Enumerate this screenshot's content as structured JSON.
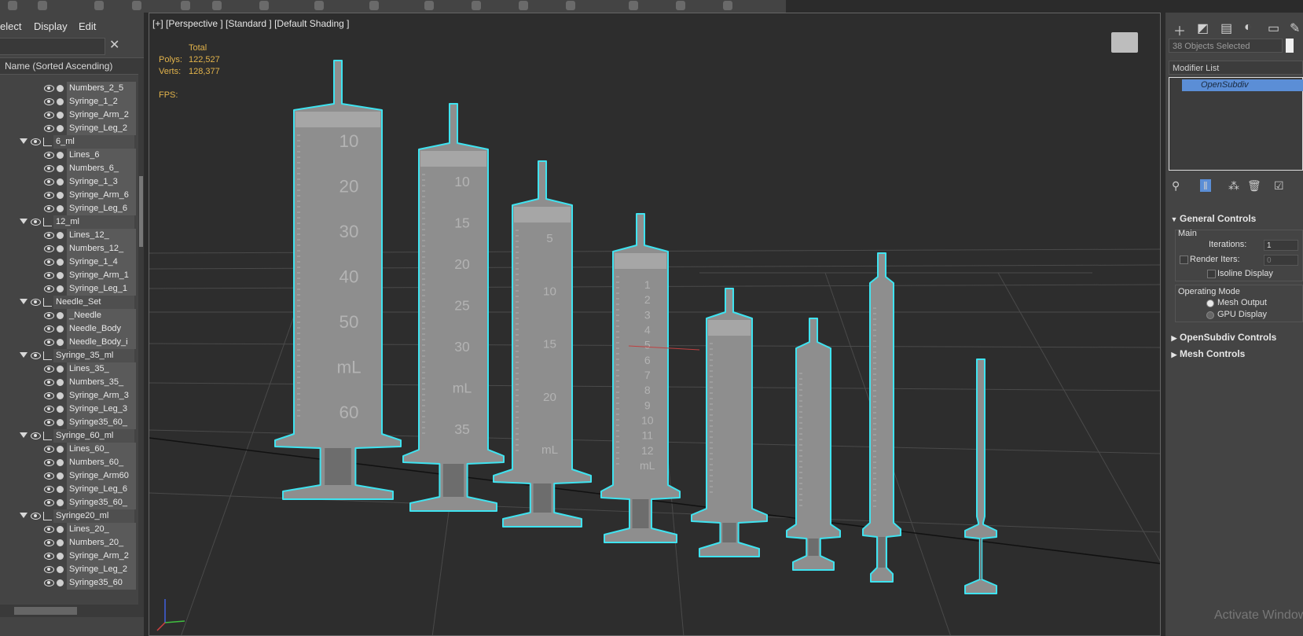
{
  "explorer": {
    "menu": [
      "elect",
      "Display",
      "Edit"
    ],
    "column_header": "Name (Sorted Ascending)",
    "rows": [
      {
        "label": "Numbers_2_5",
        "layer": false
      },
      {
        "label": "Syringe_1_2",
        "layer": false
      },
      {
        "label": "Syringe_Arm_2",
        "layer": false
      },
      {
        "label": "Syringe_Leg_2",
        "layer": false
      },
      {
        "label": "6_ml",
        "layer": true
      },
      {
        "label": "Lines_6",
        "layer": false
      },
      {
        "label": "Numbers_6_",
        "layer": false
      },
      {
        "label": "Syringe_1_3",
        "layer": false
      },
      {
        "label": "Syringe_Arm_6",
        "layer": false
      },
      {
        "label": "Syringe_Leg_6",
        "layer": false
      },
      {
        "label": "12_ml",
        "layer": true
      },
      {
        "label": "Lines_12_",
        "layer": false
      },
      {
        "label": "Numbers_12_",
        "layer": false
      },
      {
        "label": "Syringe_1_4",
        "layer": false
      },
      {
        "label": "Syringe_Arm_1",
        "layer": false
      },
      {
        "label": "Syringe_Leg_1",
        "layer": false
      },
      {
        "label": "Needle_Set",
        "layer": true
      },
      {
        "label": "_Needle",
        "layer": false
      },
      {
        "label": "Needle_Body",
        "layer": false
      },
      {
        "label": "Needle_Body_i",
        "layer": false
      },
      {
        "label": "Syringe_35_ml",
        "layer": true
      },
      {
        "label": "Lines_35_",
        "layer": false
      },
      {
        "label": "Numbers_35_",
        "layer": false
      },
      {
        "label": "Syringe_Arm_3",
        "layer": false
      },
      {
        "label": "Syringe_Leg_3",
        "layer": false
      },
      {
        "label": "Syringe35_60_",
        "layer": false
      },
      {
        "label": "Syringe_60_ml",
        "layer": true
      },
      {
        "label": "Lines_60_",
        "layer": false
      },
      {
        "label": "Numbers_60_",
        "layer": false
      },
      {
        "label": "Syringe_Arm60",
        "layer": false
      },
      {
        "label": "Syringe_Leg_6",
        "layer": false
      },
      {
        "label": "Syringe35_60_",
        "layer": false
      },
      {
        "label": "Syringe20_ml",
        "layer": true
      },
      {
        "label": "Lines_20_",
        "layer": false
      },
      {
        "label": "Numbers_20_",
        "layer": false
      },
      {
        "label": "Syringe_Arm_2",
        "layer": false
      },
      {
        "label": "Syringe_Leg_2",
        "layer": false
      },
      {
        "label": "Syringe35_60",
        "layer": false
      }
    ]
  },
  "viewport": {
    "label": "[+] [Perspective ] [Standard ] [Default Shading ]",
    "stats_title": "Total",
    "polys_label": "Polys:",
    "polys_value": "122,527",
    "verts_label": "Verts:",
    "verts_value": "128,377",
    "fps_label": "FPS:",
    "syringe1_marks": [
      "10",
      "20",
      "30",
      "40",
      "50",
      "mL",
      "60"
    ],
    "syringe2_marks": [
      "10",
      "15",
      "20",
      "25",
      "30",
      "mL",
      "35"
    ],
    "syringe3_marks": [
      "5",
      "10",
      "15",
      "20",
      "mL"
    ],
    "syringe4_marks": [
      "1",
      "2",
      "3",
      "4",
      "5",
      "6",
      "7",
      "8",
      "9",
      "10",
      "11",
      "12",
      "mL"
    ],
    "selection_color": "#3fe3f0"
  },
  "command_panel": {
    "selection_text": "38 Objects Selected",
    "modifier_list": "Modifier List",
    "stack_item": "OpenSubdiv",
    "general_controls": "General Controls",
    "main_group": "Main",
    "iterations_label": "Iterations:",
    "iterations_value": "1",
    "render_iters_label": "Render Iters:",
    "render_iters_value": "0",
    "isoline_label": "Isoline Display",
    "operating_mode": "Operating Mode",
    "mesh_output": "Mesh Output",
    "gpu_display": "GPU Display",
    "opensubdiv_controls": "OpenSubdiv Controls",
    "mesh_controls": "Mesh Controls",
    "accent": "#5b8ed6"
  },
  "watermark": "Activate Windows"
}
